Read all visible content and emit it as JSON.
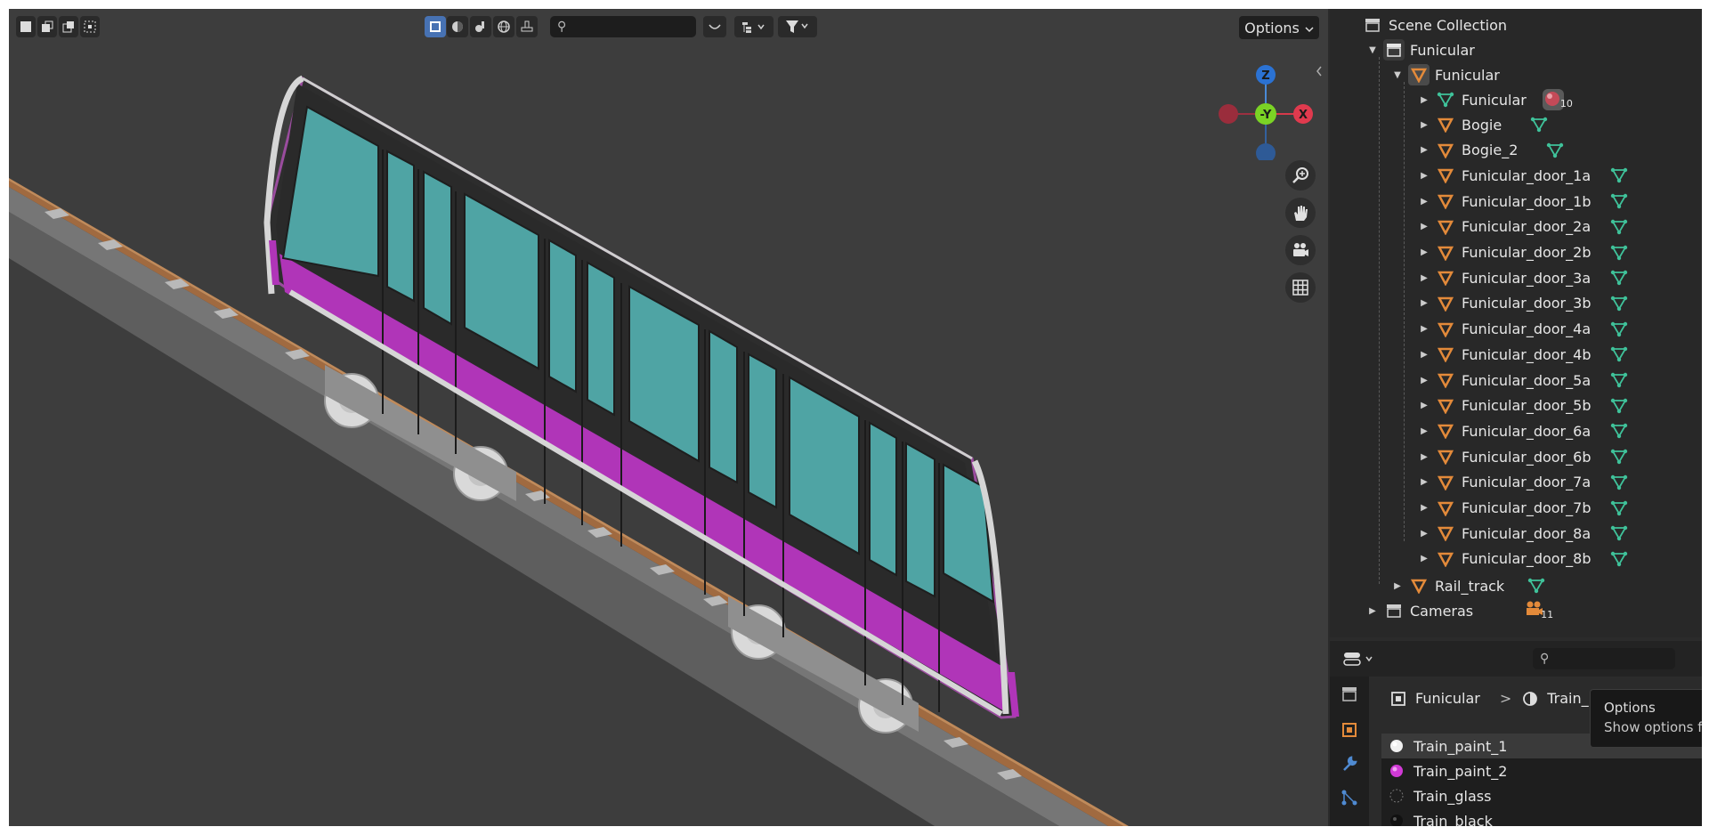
{
  "viewport": {
    "search_glyph": "⚲",
    "options_label": "Options",
    "gizmo": {
      "z": "Z",
      "neg_y": "-Y",
      "x": "X"
    },
    "colors": {
      "background": "#3d3d3d",
      "train_body": "#2f2f2f",
      "window": "#4fa4a4",
      "stripe": "#b035b8",
      "rail": "#a06a40",
      "selected_outline": "#9a4c9e"
    }
  },
  "outliner": {
    "scene_collection": "Scene Collection",
    "collection_funicular": "Funicular",
    "object_funicular": "Funicular",
    "mesh_funicular": "Funicular",
    "material_count": "10",
    "children": [
      "Bogie",
      "Bogie_2",
      "Funicular_door_1a",
      "Funicular_door_1b",
      "Funicular_door_2a",
      "Funicular_door_2b",
      "Funicular_door_3a",
      "Funicular_door_3b",
      "Funicular_door_4a",
      "Funicular_door_4b",
      "Funicular_door_5a",
      "Funicular_door_5b",
      "Funicular_door_6a",
      "Funicular_door_6b",
      "Funicular_door_7a",
      "Funicular_door_7b",
      "Funicular_door_8a",
      "Funicular_door_8b"
    ],
    "rail_track": "Rail_track",
    "cameras": "Cameras",
    "camera_count": "11",
    "colors": {
      "object_icon": "#e38a3a",
      "mesh_icon": "#3fc29a",
      "camera_icon": "#e38a3a"
    }
  },
  "properties": {
    "breadcrumb_object": "Funicular",
    "breadcrumb_separator": ">",
    "breadcrumb_material": "Train_p",
    "materials": [
      {
        "name": "Train_paint_1",
        "color": "#f0f0f0"
      },
      {
        "name": "Train_paint_2",
        "color": "#d13ad6"
      },
      {
        "name": "Train_glass",
        "color": "#777777"
      },
      {
        "name": "Train_black",
        "color": "#111111"
      }
    ]
  },
  "tooltip": {
    "title": "Options",
    "description": "Show options fo"
  }
}
